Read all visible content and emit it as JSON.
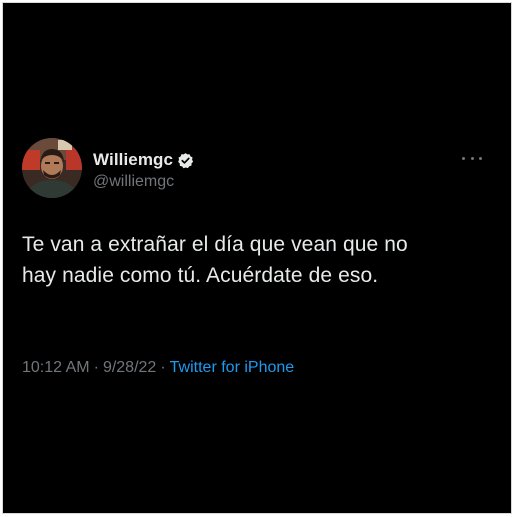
{
  "tweet": {
    "display_name": "Williemgc",
    "handle": "@williemgc",
    "verified": true,
    "text_lines": [
      "Te van a extrañar el día que vean que no",
      "hay nadie como tú. Acuérdate de eso."
    ],
    "time": "10:12 AM",
    "date": "9/28/22",
    "source": "Twitter for iPhone",
    "separator": "·"
  },
  "icons": {
    "verified": "verified-badge-icon",
    "more": "more-options-icon"
  },
  "colors": {
    "background": "#000000",
    "primary_text": "#e7e9ea",
    "secondary_text": "#71767b",
    "link": "#1d9bf0"
  }
}
